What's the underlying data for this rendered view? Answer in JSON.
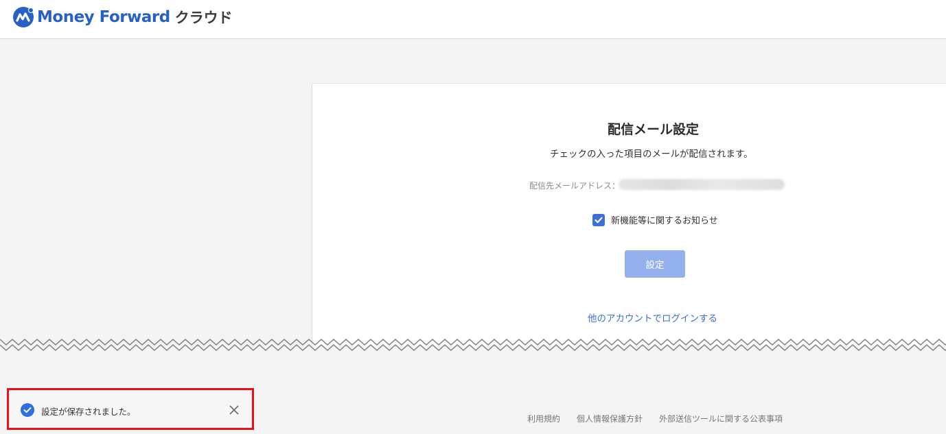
{
  "header": {
    "brand": "Money Forward",
    "product": "クラウド",
    "brand_color": "#2861c6"
  },
  "card": {
    "title": "配信メール設定",
    "subtitle": "チェックの入った項目のメールが配信されます。",
    "email_label": "配信先メールアドレス：",
    "options": [
      {
        "label": "新機能等に関するお知らせ",
        "checked": true
      }
    ],
    "submit_label": "設定",
    "other_account_link": "他のアカウントでログインする"
  },
  "footer": {
    "links": [
      "利用規約",
      "個人情報保護方針",
      "外部送信ツールに関する公表事項"
    ]
  },
  "toast": {
    "message": "設定が保存されました。",
    "status": "success",
    "icon": "check-circle-icon",
    "close_icon": "close-icon"
  },
  "colors": {
    "accent": "#3d6fd6",
    "button_disabled": "#94b1ee",
    "link": "#3b6fd4",
    "highlight_border": "#e8101a"
  }
}
